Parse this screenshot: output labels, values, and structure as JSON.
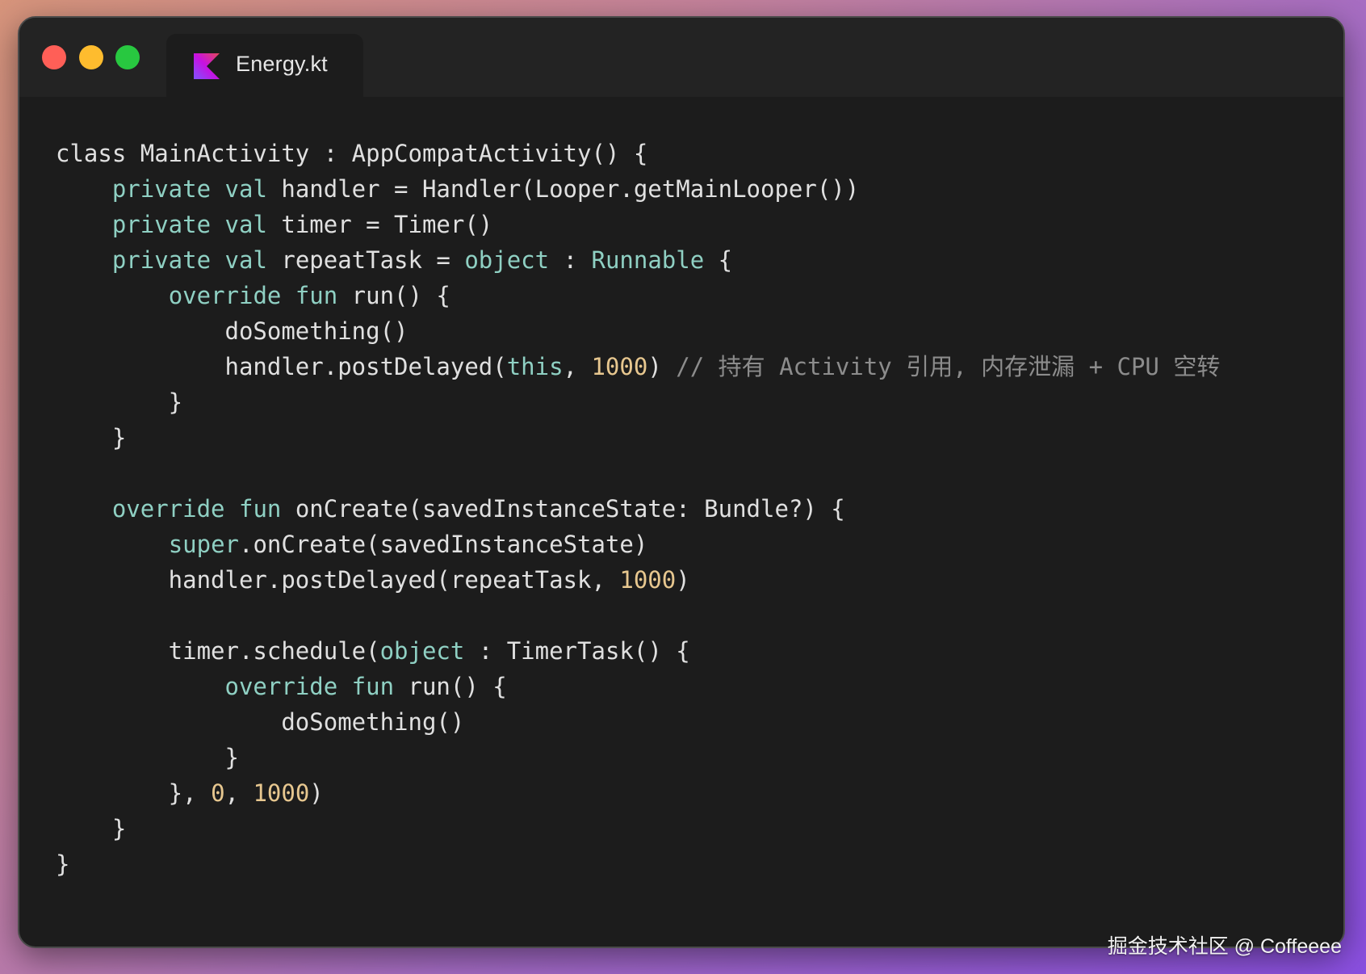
{
  "window": {
    "tab": {
      "label": "Energy.kt",
      "icon": "kotlin-icon"
    },
    "traffic_lights": {
      "close_color": "#ff5f57",
      "minimize_color": "#febc2e",
      "zoom_color": "#28c840"
    }
  },
  "colors": {
    "keyword": "#8fd0c3",
    "identifier": "#e0e0e0",
    "number": "#e7c78f",
    "comment": "#8c8c8c",
    "background": "#1c1c1c"
  },
  "code": {
    "language": "kotlin",
    "lines": [
      [
        [
          "id",
          "class MainActivity : AppCompatActivity() {"
        ]
      ],
      [
        [
          "id",
          "    "
        ],
        [
          "kw",
          "private val"
        ],
        [
          "id",
          " handler = Handler(Looper.getMainLooper())"
        ]
      ],
      [
        [
          "id",
          "    "
        ],
        [
          "kw",
          "private val"
        ],
        [
          "id",
          " timer = Timer()"
        ]
      ],
      [
        [
          "id",
          "    "
        ],
        [
          "kw",
          "private val"
        ],
        [
          "id",
          " repeatTask = "
        ],
        [
          "kw",
          "object"
        ],
        [
          "id",
          " : "
        ],
        [
          "kw",
          "Runnable"
        ],
        [
          "id",
          " {"
        ]
      ],
      [
        [
          "id",
          "        "
        ],
        [
          "kw",
          "override fun"
        ],
        [
          "id",
          " run() {"
        ]
      ],
      [
        [
          "id",
          "            doSomething()"
        ]
      ],
      [
        [
          "id",
          "            handler.postDelayed("
        ],
        [
          "kw",
          "this"
        ],
        [
          "id",
          ", "
        ],
        [
          "num",
          "1000"
        ],
        [
          "id",
          ") "
        ],
        [
          "comment",
          "// 持有 Activity 引用, 内存泄漏 + CPU 空转"
        ]
      ],
      [
        [
          "id",
          "        }"
        ]
      ],
      [
        [
          "id",
          "    }"
        ]
      ],
      [
        [
          "id",
          ""
        ]
      ],
      [
        [
          "id",
          "    "
        ],
        [
          "kw",
          "override fun"
        ],
        [
          "id",
          " onCreate(savedInstanceState: Bundle?) {"
        ]
      ],
      [
        [
          "id",
          "        "
        ],
        [
          "kw",
          "super"
        ],
        [
          "id",
          ".onCreate(savedInstanceState)"
        ]
      ],
      [
        [
          "id",
          "        handler.postDelayed(repeatTask, "
        ],
        [
          "num",
          "1000"
        ],
        [
          "id",
          ")"
        ]
      ],
      [
        [
          "id",
          ""
        ]
      ],
      [
        [
          "id",
          "        timer.schedule("
        ],
        [
          "kw",
          "object"
        ],
        [
          "id",
          " : TimerTask() {"
        ]
      ],
      [
        [
          "id",
          "            "
        ],
        [
          "kw",
          "override fun"
        ],
        [
          "id",
          " run() {"
        ]
      ],
      [
        [
          "id",
          "                doSomething()"
        ]
      ],
      [
        [
          "id",
          "            }"
        ]
      ],
      [
        [
          "id",
          "        }, "
        ],
        [
          "num",
          "0"
        ],
        [
          "id",
          ", "
        ],
        [
          "num",
          "1000"
        ],
        [
          "id",
          ")"
        ]
      ],
      [
        [
          "id",
          "    }"
        ]
      ],
      [
        [
          "id",
          "}"
        ]
      ]
    ]
  },
  "watermark": "掘金技术社区 @ Coffeeee"
}
